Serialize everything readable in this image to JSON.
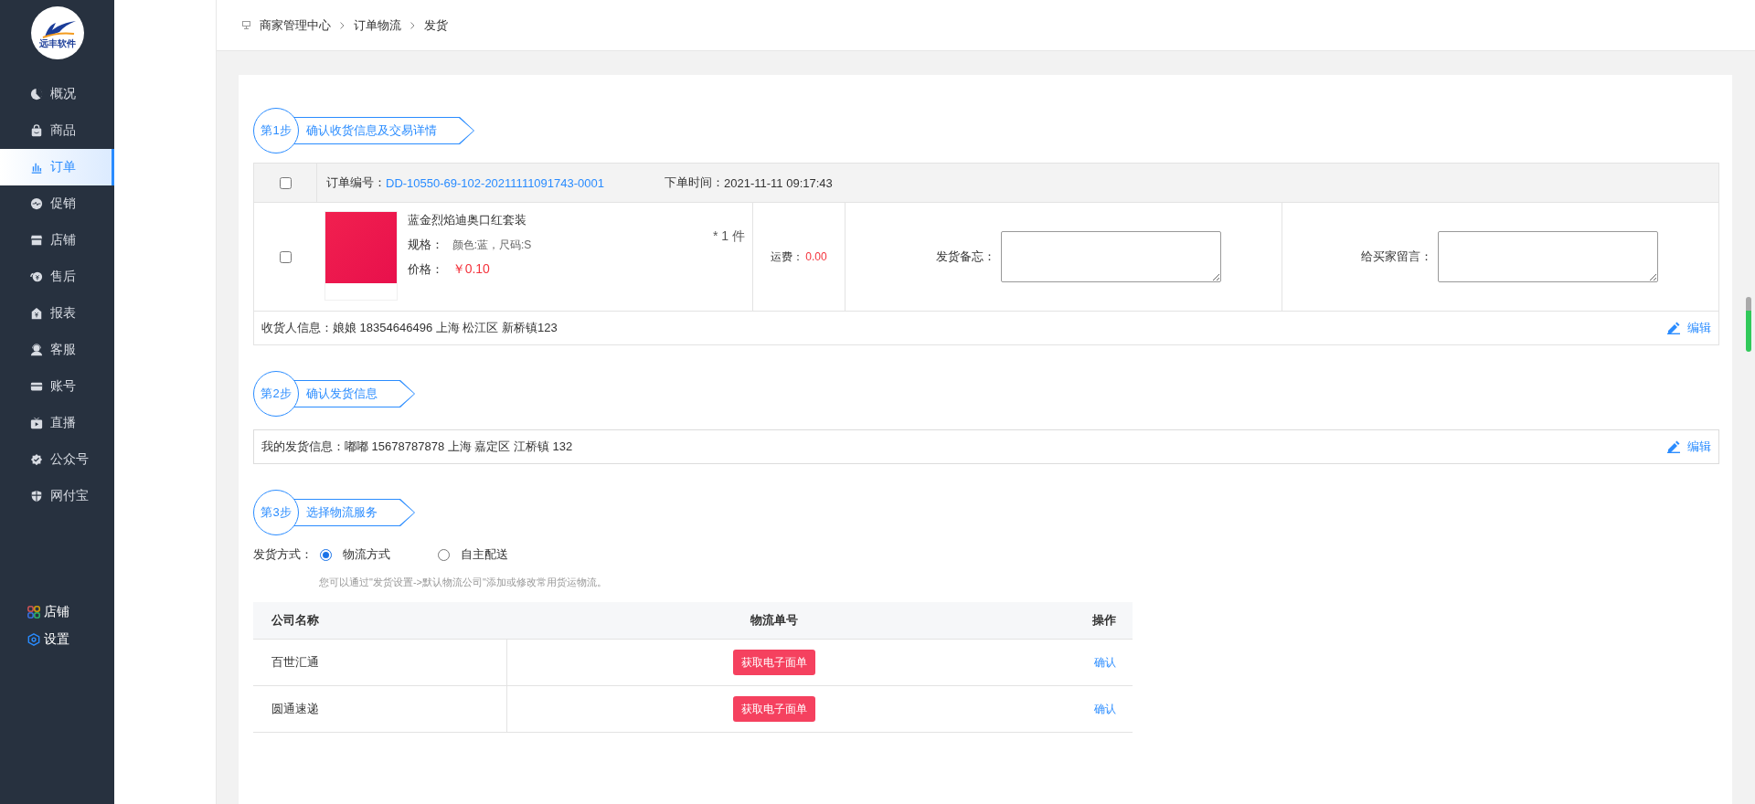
{
  "logo": {
    "text": "远丰软件"
  },
  "sidebar": {
    "items": [
      {
        "label": "概况",
        "selected": false
      },
      {
        "label": "商品",
        "selected": false
      },
      {
        "label": "订单",
        "selected": true
      },
      {
        "label": "促销",
        "selected": false
      },
      {
        "label": "店铺",
        "selected": false
      },
      {
        "label": "售后",
        "selected": false
      },
      {
        "label": "报表",
        "selected": false
      },
      {
        "label": "客服",
        "selected": false
      },
      {
        "label": "账号",
        "selected": false
      },
      {
        "label": "直播",
        "selected": false
      },
      {
        "label": "公众号",
        "selected": false
      },
      {
        "label": "网付宝",
        "selected": false
      }
    ],
    "bottom_items": [
      {
        "label": "店铺"
      },
      {
        "label": "设置"
      }
    ]
  },
  "breadcrumb": [
    "商家管理中心",
    "订单物流",
    "发货"
  ],
  "step1": {
    "badge": "第1步",
    "title": "确认收货信息及交易详情",
    "order": {
      "checked": false,
      "number_label": "订单编号：",
      "number": "DD-10550-69-102-20211111091743-0001",
      "time_label": "下单时间：",
      "time": "2021-11-11 09:17:43",
      "item": {
        "checked": false,
        "name": "蓝金烈焰迪奥口红套装",
        "spec_label": "规格：",
        "spec": "颜色:蓝，尺码:S",
        "price_label": "价格：",
        "price": "￥0.10",
        "quantity": "* 1 件",
        "freight_label": "运费：",
        "freight": "0.00"
      },
      "notes": [
        {
          "label": "发货备忘："
        },
        {
          "label": "给买家留言："
        }
      ],
      "receiver": "收货人信息：娘娘 18354646496  上海 松江区 新桥镇123",
      "edit": "编辑"
    }
  },
  "step2": {
    "badge": "第2步",
    "title": "确认发货信息",
    "sender": "我的发货信息：嘟嘟 15678787878 上海 嘉定区 江桥镇 132",
    "edit": "编辑"
  },
  "step3": {
    "badge": "第3步",
    "title": "选择物流服务",
    "method_label": "发货方式：",
    "options": [
      {
        "label": "物流方式",
        "selected": true
      },
      {
        "label": "自主配送",
        "selected": false
      }
    ],
    "hint": "您可以通过\"发货设置->默认物流公司\"添加或修改常用货运物流。",
    "table": {
      "columns": [
        "公司名称",
        "物流单号",
        "操作"
      ],
      "rows": [
        {
          "company": "百世汇通",
          "button": "获取电子面单",
          "action": "确认"
        },
        {
          "company": "圆通速递",
          "button": "获取电子面单",
          "action": "确认"
        }
      ]
    }
  }
}
